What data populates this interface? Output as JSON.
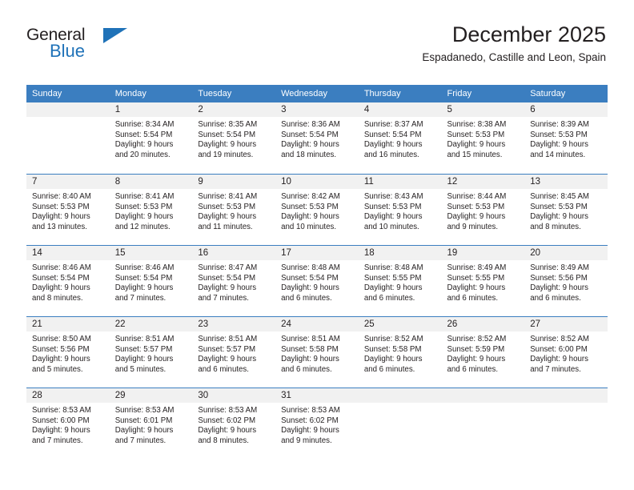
{
  "brand": {
    "name_line1": "General",
    "name_line2": "Blue",
    "primary_color": "#1f72b8"
  },
  "header": {
    "title": "December 2025",
    "subtitle": "Espadanedo, Castille and Leon, Spain"
  },
  "calendar": {
    "header_color": "#3b7ec0",
    "weekday_headers": [
      "Sunday",
      "Monday",
      "Tuesday",
      "Wednesday",
      "Thursday",
      "Friday",
      "Saturday"
    ],
    "weeks": [
      [
        {
          "day": "",
          "sunrise": "",
          "sunset": "",
          "daylight1": "",
          "daylight2": ""
        },
        {
          "day": "1",
          "sunrise": "Sunrise: 8:34 AM",
          "sunset": "Sunset: 5:54 PM",
          "daylight1": "Daylight: 9 hours",
          "daylight2": "and 20 minutes."
        },
        {
          "day": "2",
          "sunrise": "Sunrise: 8:35 AM",
          "sunset": "Sunset: 5:54 PM",
          "daylight1": "Daylight: 9 hours",
          "daylight2": "and 19 minutes."
        },
        {
          "day": "3",
          "sunrise": "Sunrise: 8:36 AM",
          "sunset": "Sunset: 5:54 PM",
          "daylight1": "Daylight: 9 hours",
          "daylight2": "and 18 minutes."
        },
        {
          "day": "4",
          "sunrise": "Sunrise: 8:37 AM",
          "sunset": "Sunset: 5:54 PM",
          "daylight1": "Daylight: 9 hours",
          "daylight2": "and 16 minutes."
        },
        {
          "day": "5",
          "sunrise": "Sunrise: 8:38 AM",
          "sunset": "Sunset: 5:53 PM",
          "daylight1": "Daylight: 9 hours",
          "daylight2": "and 15 minutes."
        },
        {
          "day": "6",
          "sunrise": "Sunrise: 8:39 AM",
          "sunset": "Sunset: 5:53 PM",
          "daylight1": "Daylight: 9 hours",
          "daylight2": "and 14 minutes."
        }
      ],
      [
        {
          "day": "7",
          "sunrise": "Sunrise: 8:40 AM",
          "sunset": "Sunset: 5:53 PM",
          "daylight1": "Daylight: 9 hours",
          "daylight2": "and 13 minutes."
        },
        {
          "day": "8",
          "sunrise": "Sunrise: 8:41 AM",
          "sunset": "Sunset: 5:53 PM",
          "daylight1": "Daylight: 9 hours",
          "daylight2": "and 12 minutes."
        },
        {
          "day": "9",
          "sunrise": "Sunrise: 8:41 AM",
          "sunset": "Sunset: 5:53 PM",
          "daylight1": "Daylight: 9 hours",
          "daylight2": "and 11 minutes."
        },
        {
          "day": "10",
          "sunrise": "Sunrise: 8:42 AM",
          "sunset": "Sunset: 5:53 PM",
          "daylight1": "Daylight: 9 hours",
          "daylight2": "and 10 minutes."
        },
        {
          "day": "11",
          "sunrise": "Sunrise: 8:43 AM",
          "sunset": "Sunset: 5:53 PM",
          "daylight1": "Daylight: 9 hours",
          "daylight2": "and 10 minutes."
        },
        {
          "day": "12",
          "sunrise": "Sunrise: 8:44 AM",
          "sunset": "Sunset: 5:53 PM",
          "daylight1": "Daylight: 9 hours",
          "daylight2": "and 9 minutes."
        },
        {
          "day": "13",
          "sunrise": "Sunrise: 8:45 AM",
          "sunset": "Sunset: 5:53 PM",
          "daylight1": "Daylight: 9 hours",
          "daylight2": "and 8 minutes."
        }
      ],
      [
        {
          "day": "14",
          "sunrise": "Sunrise: 8:46 AM",
          "sunset": "Sunset: 5:54 PM",
          "daylight1": "Daylight: 9 hours",
          "daylight2": "and 8 minutes."
        },
        {
          "day": "15",
          "sunrise": "Sunrise: 8:46 AM",
          "sunset": "Sunset: 5:54 PM",
          "daylight1": "Daylight: 9 hours",
          "daylight2": "and 7 minutes."
        },
        {
          "day": "16",
          "sunrise": "Sunrise: 8:47 AM",
          "sunset": "Sunset: 5:54 PM",
          "daylight1": "Daylight: 9 hours",
          "daylight2": "and 7 minutes."
        },
        {
          "day": "17",
          "sunrise": "Sunrise: 8:48 AM",
          "sunset": "Sunset: 5:54 PM",
          "daylight1": "Daylight: 9 hours",
          "daylight2": "and 6 minutes."
        },
        {
          "day": "18",
          "sunrise": "Sunrise: 8:48 AM",
          "sunset": "Sunset: 5:55 PM",
          "daylight1": "Daylight: 9 hours",
          "daylight2": "and 6 minutes."
        },
        {
          "day": "19",
          "sunrise": "Sunrise: 8:49 AM",
          "sunset": "Sunset: 5:55 PM",
          "daylight1": "Daylight: 9 hours",
          "daylight2": "and 6 minutes."
        },
        {
          "day": "20",
          "sunrise": "Sunrise: 8:49 AM",
          "sunset": "Sunset: 5:56 PM",
          "daylight1": "Daylight: 9 hours",
          "daylight2": "and 6 minutes."
        }
      ],
      [
        {
          "day": "21",
          "sunrise": "Sunrise: 8:50 AM",
          "sunset": "Sunset: 5:56 PM",
          "daylight1": "Daylight: 9 hours",
          "daylight2": "and 5 minutes."
        },
        {
          "day": "22",
          "sunrise": "Sunrise: 8:51 AM",
          "sunset": "Sunset: 5:57 PM",
          "daylight1": "Daylight: 9 hours",
          "daylight2": "and 5 minutes."
        },
        {
          "day": "23",
          "sunrise": "Sunrise: 8:51 AM",
          "sunset": "Sunset: 5:57 PM",
          "daylight1": "Daylight: 9 hours",
          "daylight2": "and 6 minutes."
        },
        {
          "day": "24",
          "sunrise": "Sunrise: 8:51 AM",
          "sunset": "Sunset: 5:58 PM",
          "daylight1": "Daylight: 9 hours",
          "daylight2": "and 6 minutes."
        },
        {
          "day": "25",
          "sunrise": "Sunrise: 8:52 AM",
          "sunset": "Sunset: 5:58 PM",
          "daylight1": "Daylight: 9 hours",
          "daylight2": "and 6 minutes."
        },
        {
          "day": "26",
          "sunrise": "Sunrise: 8:52 AM",
          "sunset": "Sunset: 5:59 PM",
          "daylight1": "Daylight: 9 hours",
          "daylight2": "and 6 minutes."
        },
        {
          "day": "27",
          "sunrise": "Sunrise: 8:52 AM",
          "sunset": "Sunset: 6:00 PM",
          "daylight1": "Daylight: 9 hours",
          "daylight2": "and 7 minutes."
        }
      ],
      [
        {
          "day": "28",
          "sunrise": "Sunrise: 8:53 AM",
          "sunset": "Sunset: 6:00 PM",
          "daylight1": "Daylight: 9 hours",
          "daylight2": "and 7 minutes."
        },
        {
          "day": "29",
          "sunrise": "Sunrise: 8:53 AM",
          "sunset": "Sunset: 6:01 PM",
          "daylight1": "Daylight: 9 hours",
          "daylight2": "and 7 minutes."
        },
        {
          "day": "30",
          "sunrise": "Sunrise: 8:53 AM",
          "sunset": "Sunset: 6:02 PM",
          "daylight1": "Daylight: 9 hours",
          "daylight2": "and 8 minutes."
        },
        {
          "day": "31",
          "sunrise": "Sunrise: 8:53 AM",
          "sunset": "Sunset: 6:02 PM",
          "daylight1": "Daylight: 9 hours",
          "daylight2": "and 9 minutes."
        },
        {
          "day": "",
          "sunrise": "",
          "sunset": "",
          "daylight1": "",
          "daylight2": ""
        },
        {
          "day": "",
          "sunrise": "",
          "sunset": "",
          "daylight1": "",
          "daylight2": ""
        },
        {
          "day": "",
          "sunrise": "",
          "sunset": "",
          "daylight1": "",
          "daylight2": ""
        }
      ]
    ]
  }
}
